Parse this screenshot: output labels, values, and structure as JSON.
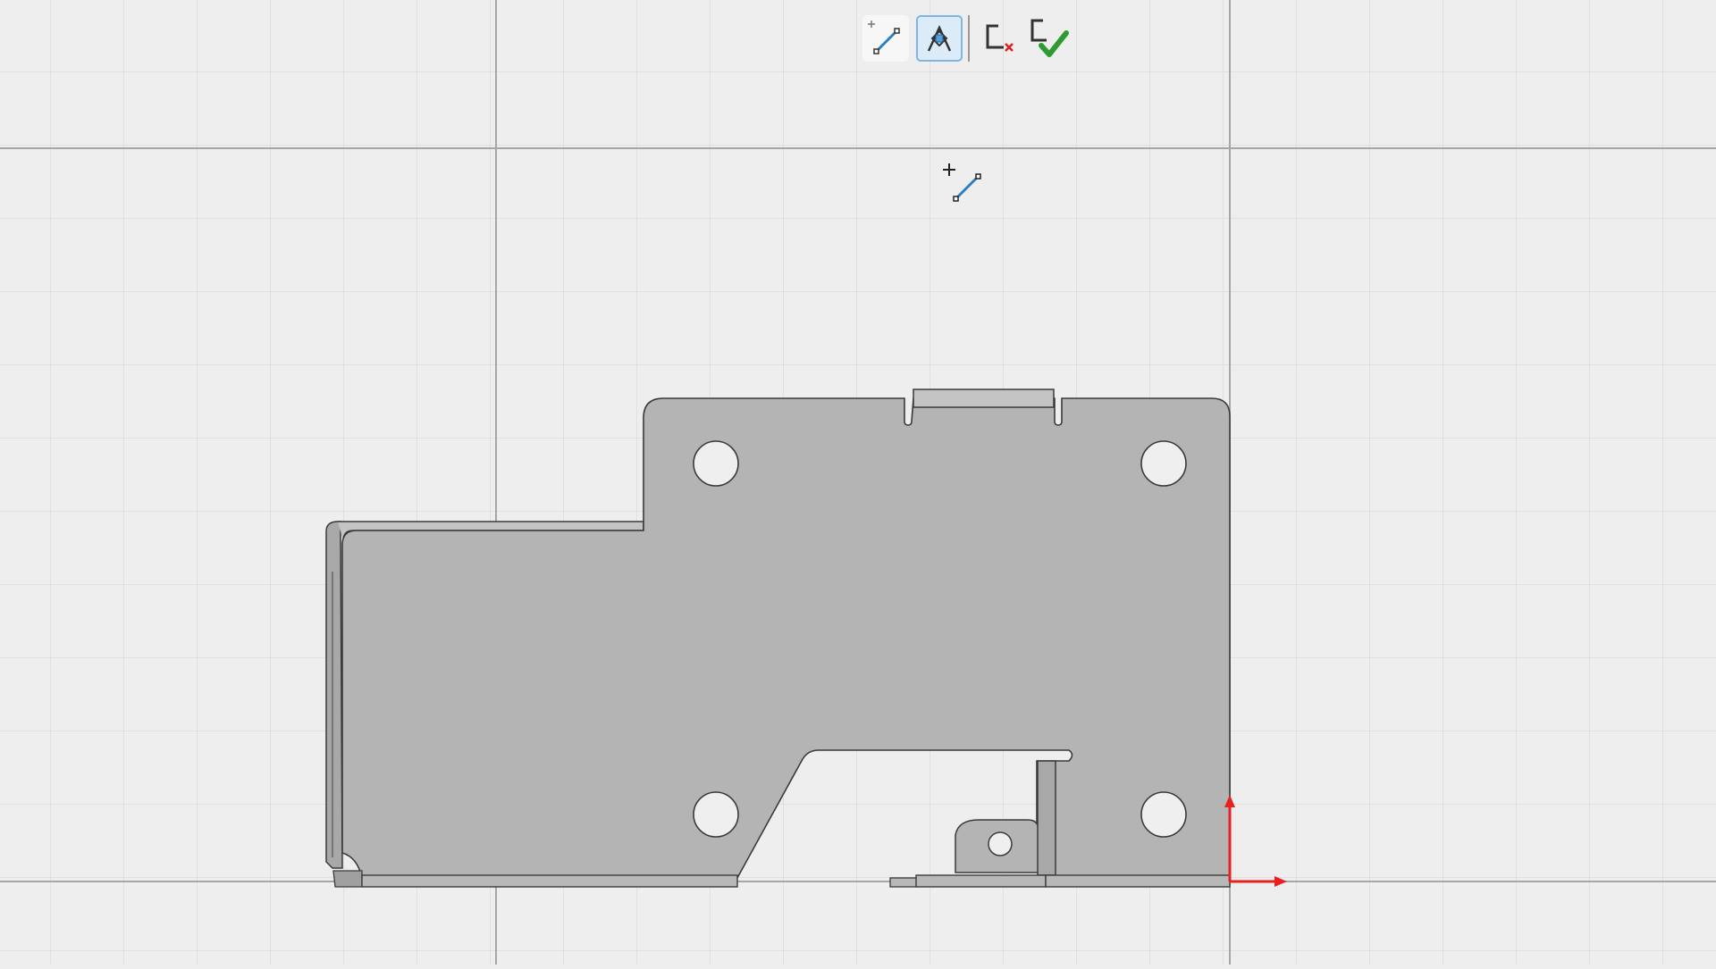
{
  "app": {
    "view": "Sketch",
    "background": "#eeeeee",
    "grid_color": "#d6d6d6",
    "axis_color": "#9a9a9a"
  },
  "toolbar": {
    "items": [
      {
        "id": "line-tool",
        "icon": "sketch-line-icon",
        "active": false
      },
      {
        "id": "project-tool",
        "icon": "project-edge-icon",
        "active": true
      },
      {
        "id": "cancel-sketch",
        "icon": "cancel-sketch-icon",
        "active": false
      },
      {
        "id": "finish-sketch",
        "icon": "finish-sketch-icon",
        "active": false
      }
    ]
  },
  "part": {
    "fill": "#b4b4b4",
    "edge_color": "#3a3a3a",
    "origin_axes_color": "#e82020"
  },
  "cursor": {
    "icon": "line-cursor-icon"
  }
}
